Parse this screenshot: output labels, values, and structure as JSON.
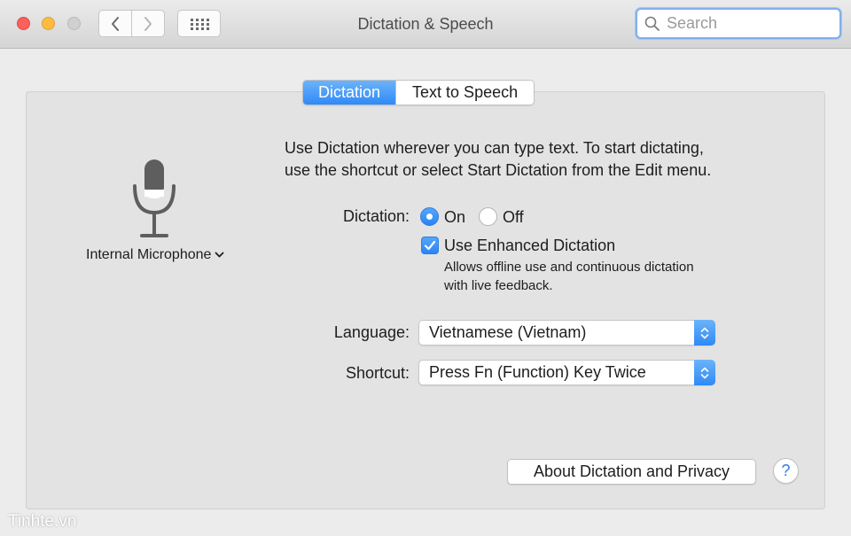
{
  "window": {
    "title": "Dictation & Speech"
  },
  "toolbar": {
    "back_icon": "chevron-left-icon",
    "forward_icon": "chevron-right-icon",
    "grid_icon": "grid-icon",
    "search_placeholder": "Search"
  },
  "tabs": [
    {
      "label": "Dictation",
      "active": true
    },
    {
      "label": "Text to Speech",
      "active": false
    }
  ],
  "microphone": {
    "icon": "microphone-icon",
    "label": "Internal Microphone"
  },
  "description": {
    "line1": "Use Dictation wherever you can type text. To start dictating,",
    "line2": "use the shortcut or select Start Dictation from the Edit menu."
  },
  "dictation": {
    "label": "Dictation:",
    "on_label": "On",
    "off_label": "Off",
    "selected": "On"
  },
  "enhanced": {
    "label": "Use Enhanced Dictation",
    "checked": true,
    "note_line1": "Allows offline use and continuous dictation",
    "note_line2": "with live feedback."
  },
  "language": {
    "label": "Language:",
    "value": "Vietnamese (Vietnam)"
  },
  "shortcut": {
    "label": "Shortcut:",
    "value": "Press Fn (Function) Key Twice"
  },
  "buttons": {
    "about": "About Dictation and Privacy",
    "help": "?"
  },
  "watermark": "Tinhte.vn",
  "colors": {
    "accent": "#2f8af6",
    "close": "#fc605c",
    "minimize": "#fdbc40",
    "zoom_disabled": "#d0d0d0"
  }
}
